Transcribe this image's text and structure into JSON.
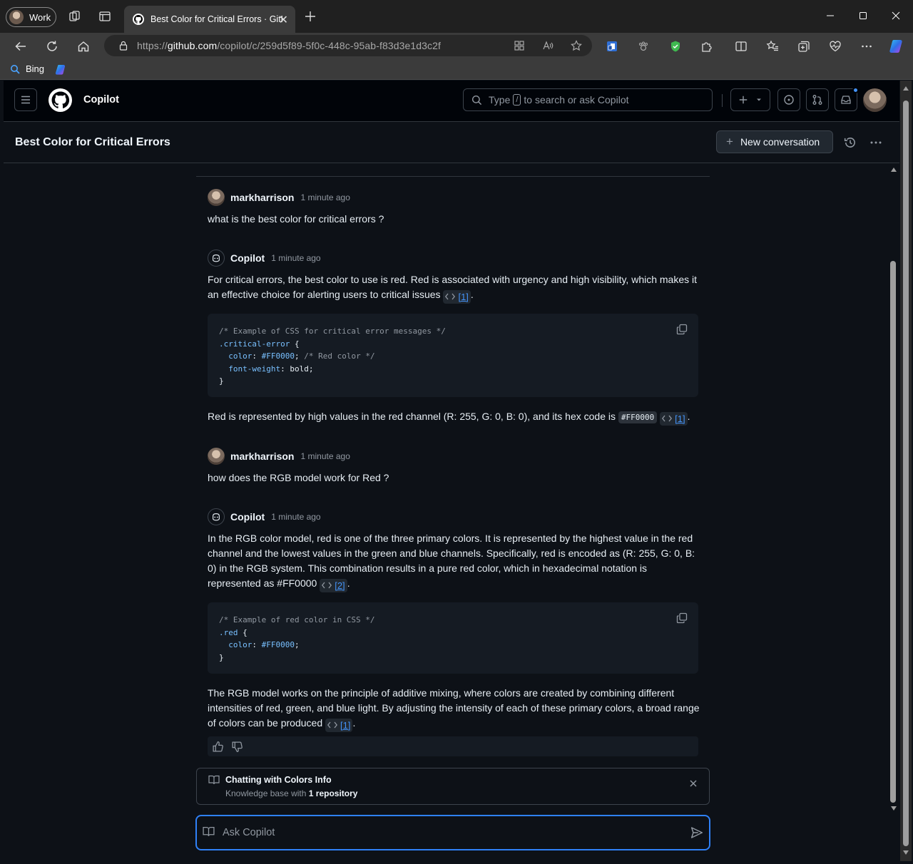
{
  "browser": {
    "profile_label": "Work",
    "active_tab_title": "Best Color for Critical Errors · GitHub",
    "url_prefix": "https://",
    "url_host": "github.com",
    "url_path": "/copilot/c/259d5f89-5f0c-448c-95ab-f83d3e1d3c2f",
    "favorites": [
      {
        "label": "Bing"
      }
    ]
  },
  "header": {
    "app_name": "Copilot",
    "search_prefix": "Type",
    "search_key": "/",
    "search_suffix": "to search or ask Copilot"
  },
  "conversation": {
    "title": "Best Color for Critical Errors",
    "new_conversation_label": "New conversation"
  },
  "messages": [
    {
      "author": "markharrison",
      "time": "1 minute ago",
      "text": "what is the best color for critical errors ?"
    },
    {
      "author": "Copilot",
      "time": "1 minute ago",
      "p1": "For critical errors, the best color to use is red. Red is associated with urgency and high visibility, which makes it an effective choice for alerting users to critical issues",
      "p1_ref": "[1]",
      "code": {
        "comment": "/* Example of CSS for critical error messages */",
        "selector": ".critical-error",
        "prop1": "color",
        "val1": "#FF0000",
        "comment2": "/* Red color */",
        "prop2": "font-weight",
        "val2": "bold"
      },
      "p2": "Red is represented by high values in the red channel (R: 255, G: 0, B: 0), and its hex code is",
      "p2_code": "#FF0000",
      "p2_ref": "[1]"
    },
    {
      "author": "markharrison",
      "time": "1 minute ago",
      "text": "how does the RGB model work for Red ?"
    },
    {
      "author": "Copilot",
      "time": "1 minute ago",
      "p1": "In the RGB color model, red is one of the three primary colors. It is represented by the highest value in the red channel and the lowest values in the green and blue channels. Specifically, red is encoded as (R: 255, G: 0, B: 0) in the RGB system. This combination results in a pure red color, which in hexadecimal notation is represented as #FF0000",
      "p1_ref": "[2]",
      "code": {
        "comment": "/* Example of red color in CSS */",
        "selector": ".red",
        "prop1": "color",
        "val1": "#FF0000"
      },
      "p2": "The RGB model works on the principle of additive mixing, where colors are created by combining different intensities of red, green, and blue light. By adjusting the intensity of each of these primary colors, a broad range of colors can be produced",
      "p2_ref": "[1]"
    }
  ],
  "knowledge_base": {
    "title": "Chatting with Colors Info",
    "sub_prefix": "Knowledge base with",
    "sub_count": "1 repository"
  },
  "ask": {
    "placeholder": "Ask Copilot"
  },
  "colors": {
    "accent": "#2f81f7",
    "link": "#4493f8",
    "bg": "#0d1117"
  }
}
